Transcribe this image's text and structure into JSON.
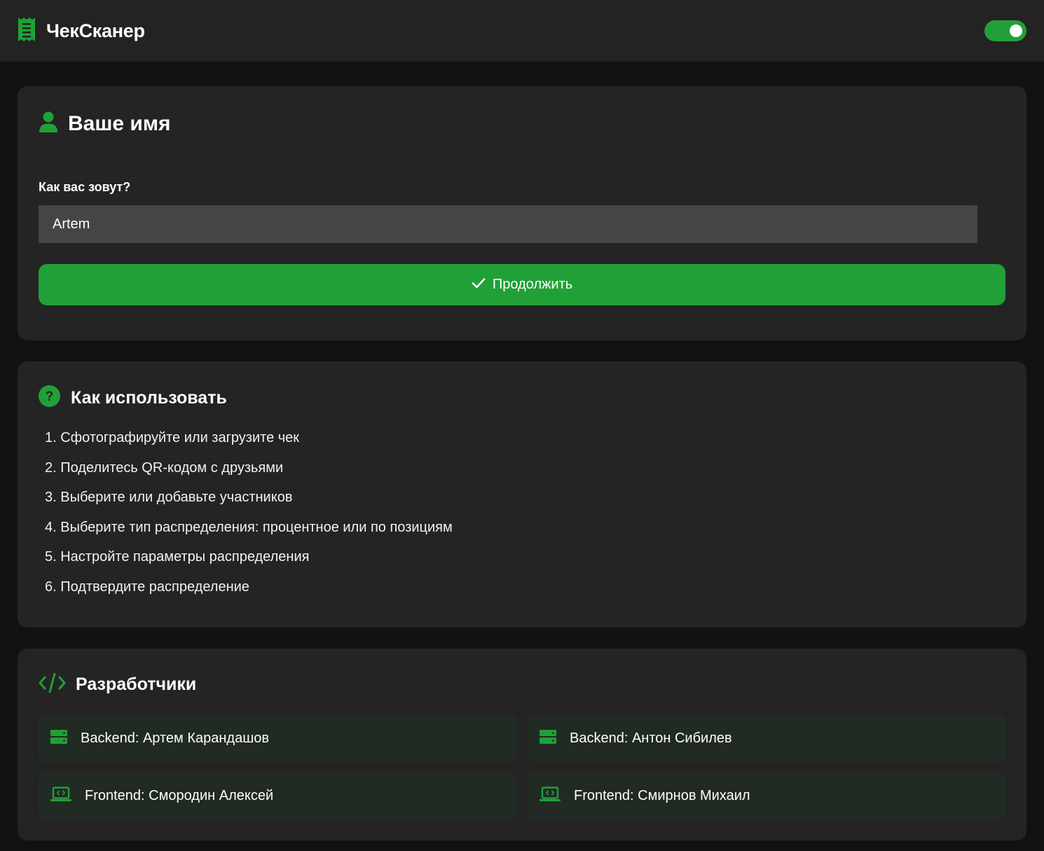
{
  "app": {
    "title": "ЧекСканер",
    "icons": {
      "logo": "receipt-icon",
      "theme": "toggle-switch"
    },
    "colors": {
      "accent": "#21a038",
      "background": "#121212",
      "card": "#242424",
      "topbar": "#232323",
      "input": "#454545",
      "dev_card": "#212b24"
    },
    "theme_toggle_on": true
  },
  "name_section": {
    "title": "Ваше имя",
    "icon": "user-icon",
    "label": "Как вас зовут?",
    "input_value": "Artem",
    "button_label": "Продолжить",
    "button_icon": "check-icon"
  },
  "help_section": {
    "title": "Как использовать",
    "icon": "question-circle-icon",
    "steps": [
      "1. Сфотографируйте или загрузите чек",
      "2. Поделитесь QR-кодом с друзьями",
      "3. Выберите или добавьте участников",
      "4. Выберите тип распределения: процентное или по позициям",
      "5. Настройте параметры распределения",
      "6. Подтвердите распределение"
    ]
  },
  "devs_section": {
    "title": "Разработчики",
    "icon": "code-icon",
    "developers": [
      {
        "label": "Backend: Артем Карандашов",
        "icon": "server-icon"
      },
      {
        "label": "Backend: Антон Сибилев",
        "icon": "server-icon"
      },
      {
        "label": "Frontend: Смородин Алексей",
        "icon": "laptop-code-icon"
      },
      {
        "label": "Frontend: Смирнов Михаил",
        "icon": "laptop-code-icon"
      }
    ]
  }
}
